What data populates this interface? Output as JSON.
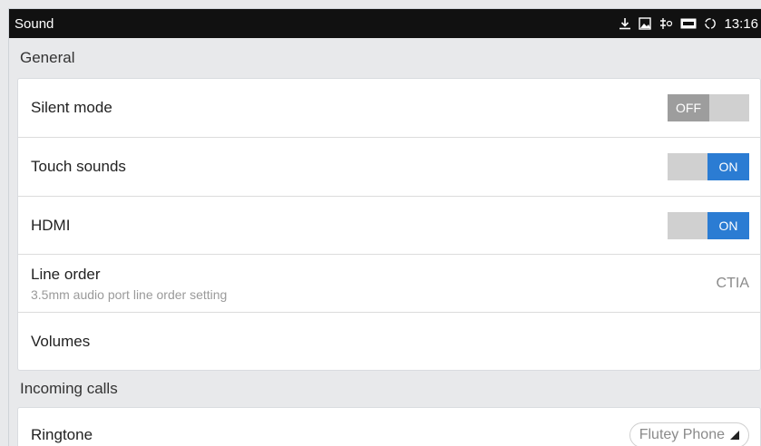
{
  "statusbar": {
    "title": "Sound",
    "time": "13:16",
    "icons": [
      "download-icon",
      "image-icon",
      "usb-debug-icon",
      "hdmi-icon",
      "sync-icon"
    ]
  },
  "general": {
    "header": "General",
    "rows": [
      {
        "label": "Silent mode",
        "toggle": "OFF"
      },
      {
        "label": "Touch sounds",
        "toggle": "ON"
      },
      {
        "label": "HDMI",
        "toggle": "ON"
      },
      {
        "label": "Line order",
        "sub": "3.5mm audio port line order setting",
        "value": "CTIA"
      },
      {
        "label": "Volumes"
      }
    ]
  },
  "incoming": {
    "header": "Incoming calls",
    "ringtone_label": "Ringtone",
    "ringtone_value": "Flutey Phone"
  },
  "colors": {
    "accent": "#2b7cd3",
    "off": "#9d9d9d"
  }
}
